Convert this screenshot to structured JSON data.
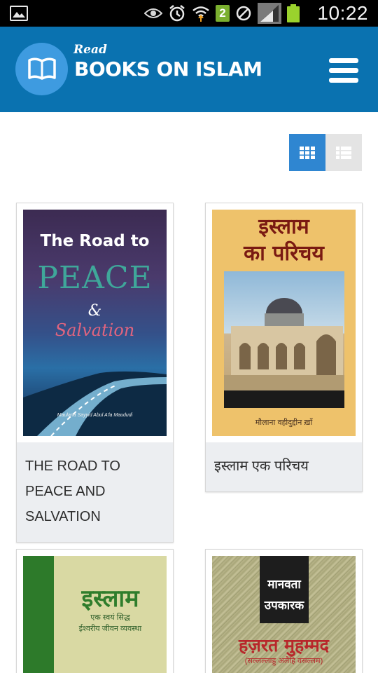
{
  "status_bar": {
    "time": "10:22",
    "sim_slot": "2",
    "icons": [
      "gallery-icon",
      "eye-icon",
      "alarm-icon",
      "wifi-icon",
      "sim-badge",
      "no-sync-icon",
      "signal-icon",
      "battery-icon"
    ]
  },
  "header": {
    "logo_small": "Read",
    "logo_title": "BOOKS ON ISLAM",
    "menu_icon": "hamburger-menu-icon",
    "background": "#0a72b0"
  },
  "view_toggle": {
    "active": "grid",
    "grid_icon": "grid-view-icon",
    "list_icon": "list-view-icon",
    "active_color": "#2f86d1"
  },
  "books": [
    {
      "title": "THE ROAD TO PEACE AND SALVATION",
      "cover": {
        "line1": "The Road to",
        "line2": "PEACE",
        "line3": "&",
        "line4": "Salvation",
        "author": "Maulana Sayyid Abul A'la Maududi"
      }
    },
    {
      "title": "इस्लाम एक परिचय",
      "cover": {
        "line1": "इस्लाम",
        "line2": "का परिचय",
        "author": "मौलाना वहीदुद्दीन ख़ाँ"
      }
    },
    {
      "title": "",
      "cover": {
        "line1": "इस्लाम",
        "line2": "एक स्वयं सिद्ध",
        "line3": "ईश्वरीय जीवन व्यवस्था"
      }
    },
    {
      "title": "",
      "cover": {
        "line1": "मानवता",
        "line2": "उपकारक",
        "line3": "हज़रत मुहम्मद",
        "line4": "(सल्लल्लाहु अलैहि वसल्लम)"
      }
    }
  ]
}
